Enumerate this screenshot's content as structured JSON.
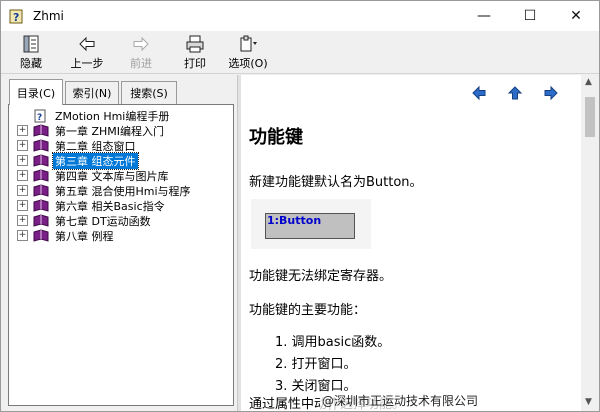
{
  "window": {
    "title": "Zhmi",
    "min_glyph": "—",
    "max_glyph": "☐",
    "close_glyph": "✕"
  },
  "toolbar": {
    "hide_label": "隐藏",
    "back_label": "上一步",
    "forward_label": "前进",
    "print_label": "打印",
    "options_label": "选项(O)"
  },
  "tabs": [
    {
      "label": "目录(C)",
      "active": true
    },
    {
      "label": "索引(N)",
      "active": false
    },
    {
      "label": "搜索(S)",
      "active": false
    }
  ],
  "tree": {
    "root": "ZMotion Hmi编程手册",
    "items": [
      {
        "label": "第一章 ZHMI编程入门",
        "selected": false
      },
      {
        "label": "第二章 组态窗口",
        "selected": false
      },
      {
        "label": "第三章 组态元件",
        "selected": true
      },
      {
        "label": "第四章 文本库与图片库",
        "selected": false
      },
      {
        "label": "第五章 混合使用Hmi与程序",
        "selected": false
      },
      {
        "label": "第六章  相关Basic指令",
        "selected": false
      },
      {
        "label": "第七章 DT运动函数",
        "selected": false
      },
      {
        "label": "第八章 例程",
        "selected": false
      }
    ],
    "expander_glyph": "+"
  },
  "content": {
    "heading": "功能键",
    "intro": "新建功能键默认名为Button。",
    "demo_button_label": "1:Button",
    "note": "功能键无法绑定寄存器。",
    "features_title": "功能键的主要功能：",
    "features": [
      "1.  调用basic函数。",
      "2.  打开窗口。",
      "3.  关闭窗口。"
    ],
    "trailing": "通过属性中动作选择功能。"
  },
  "watermark": "@深圳市正运动技术有限公司",
  "colors": {
    "selection": "#0078d7",
    "book": "#7a1f86",
    "nav_arrow": "#2a6cc8"
  }
}
